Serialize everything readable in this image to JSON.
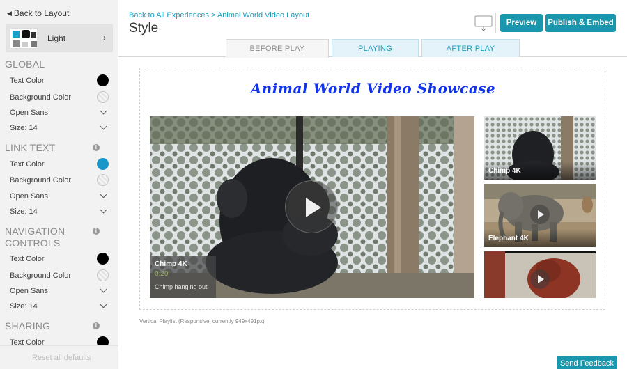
{
  "sidebar": {
    "back_label": "Back to Layout",
    "theme_label": "Light",
    "sections": {
      "global": "GLOBAL",
      "link_text": "LINK TEXT",
      "navigation_1": "NAVIGATION",
      "navigation_2": "CONTROLS",
      "sharing": "SHARING"
    },
    "labels": {
      "text_color": "Text Color",
      "background_color": "Background Color",
      "font": "Open Sans",
      "size": "Size: 14"
    },
    "colors": {
      "global_text": "#000000",
      "link_text": "#1a97c9",
      "nav_text": "#000000",
      "sharing_text": "#000000"
    },
    "reset_label": "Reset all defaults"
  },
  "header": {
    "breadcrumb": "Back to All Experiences > Animal World Video Layout",
    "title": "Style",
    "preview_label": "Preview",
    "publish_label": "Publish & Embed",
    "monitor_icon": "monitor-icon"
  },
  "tabs": [
    {
      "label": "BEFORE PLAY",
      "active": true
    },
    {
      "label": "PLAYING",
      "active": false
    },
    {
      "label": "AFTER PLAY",
      "active": false
    }
  ],
  "canvas": {
    "title": "Animal World Video Showcase",
    "main_video": {
      "title": "Chimp 4K",
      "duration": "0:20",
      "description": "Chimp hanging out"
    },
    "playlist": [
      {
        "title": "Chimp 4K"
      },
      {
        "title": "Elephant 4K"
      },
      {
        "title": ""
      }
    ],
    "layout_note": "Vertical Playlist (Responsive, currently 949x491px)"
  },
  "feedback_label": "Send Feedback",
  "accent_color": "#1a97ad"
}
